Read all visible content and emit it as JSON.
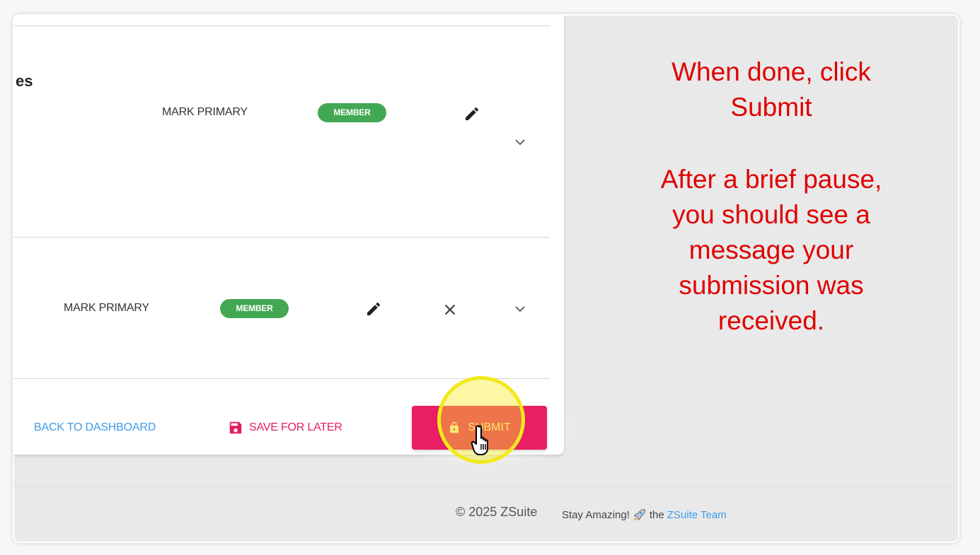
{
  "form": {
    "section_title": "es",
    "rows": [
      {
        "name": "MARK PRIMARY",
        "badge": "MEMBER",
        "has_remove": false
      },
      {
        "name": "MARK PRIMARY",
        "badge": "MEMBER",
        "has_remove": true
      }
    ],
    "icons": {
      "edit": "pencil-icon",
      "remove": "close-icon",
      "expand": "chevron-down-icon",
      "save": "floppy-disk-icon",
      "lock": "lock-icon"
    }
  },
  "actions": {
    "back_label": "BACK TO DASHBOARD",
    "save_label": "SAVE FOR LATER",
    "submit_label": "SUBMIT"
  },
  "instructions": {
    "line1": "When done, click Submit",
    "line2": "After a brief pause, you should see a message your submission was received."
  },
  "footer": {
    "copyright": "© 2025 ZSuite",
    "tagline_prefix": "Stay Amazing!",
    "tagline_mid": "the",
    "team_link": "ZSuite Team"
  },
  "colors": {
    "badge": "#43a853",
    "submit": "#e91e63",
    "link": "#3d9be9",
    "save": "#e11d5f",
    "instruction": "#e00000",
    "highlight": "#f2e91a"
  }
}
